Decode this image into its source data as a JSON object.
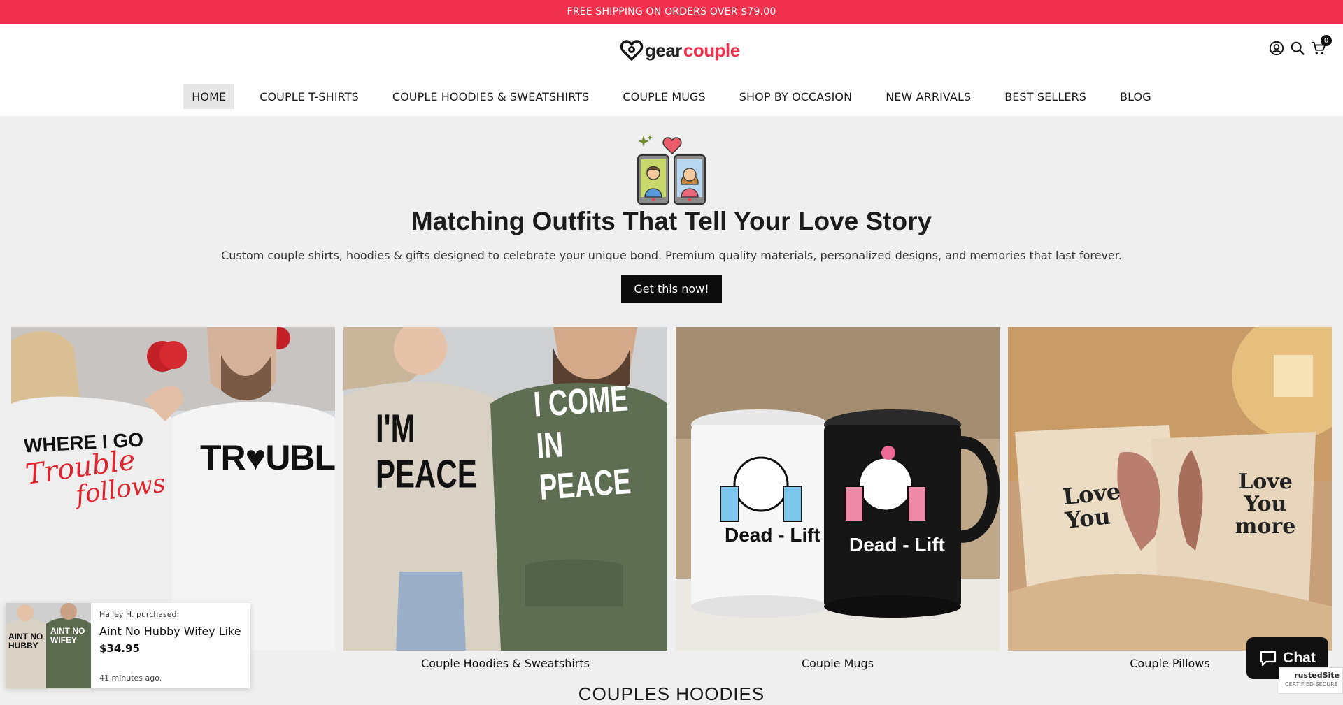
{
  "announcement": {
    "text": "FREE SHIPPING ON ORDERS OVER $79.00"
  },
  "header": {
    "logo": {
      "part1": "gear",
      "part2": "couple"
    },
    "icons": [
      "account-icon",
      "search-icon",
      "cart-icon"
    ],
    "cart_count": "0"
  },
  "nav": {
    "items": [
      {
        "label": "HOME",
        "active": true
      },
      {
        "label": "COUPLE T-SHIRTS"
      },
      {
        "label": "COUPLE HOODIES & SWEATSHIRTS"
      },
      {
        "label": "COUPLE MUGS"
      },
      {
        "label": "SHOP BY OCCASION"
      },
      {
        "label": "NEW ARRIVALS"
      },
      {
        "label": "BEST SELLERS"
      },
      {
        "label": "BLOG"
      }
    ]
  },
  "hero": {
    "title": "Matching Outfits That Tell Your Love Story",
    "subtitle": "Custom couple shirts, hoodies & gifts designed to celebrate your unique bond. Premium quality materials, personalized designs, and memories that last forever.",
    "cta": "Get this now!"
  },
  "collections": [
    {
      "caption": "",
      "print_left_a": "WHERE I GO",
      "print_left_b": "Trouble",
      "print_left_c": "follows",
      "print_right": "TR♥UBLE"
    },
    {
      "caption": "Couple Hoodies & Sweatshirts",
      "print_left": "I'M PEACE",
      "print_right": "I COME IN PEACE"
    },
    {
      "caption": "Couple Mugs",
      "print_left": "Dead - Lift",
      "print_right": "Dead - Lift"
    },
    {
      "caption": "Couple Pillows",
      "print_left": "Love You",
      "print_right": "Love You more"
    }
  ],
  "next_section": {
    "heading": "COUPLES HOODIES"
  },
  "toast": {
    "who": "Hailey H. purchased:",
    "product": "Aint No Hubby Wifey Like",
    "price": "$34.95",
    "ago": "41 minutes ago.",
    "thumb_left": "AINT NO HUBBY",
    "thumb_right": "AINT NO WIFEY"
  },
  "chat": {
    "label": "Chat"
  },
  "trust": {
    "line1": "rustedSite",
    "line2": "CERTIFIED SECURE"
  },
  "colors": {
    "accent": "#f0314d",
    "button": "#0c0c0c",
    "page_bg": "#efefef"
  }
}
